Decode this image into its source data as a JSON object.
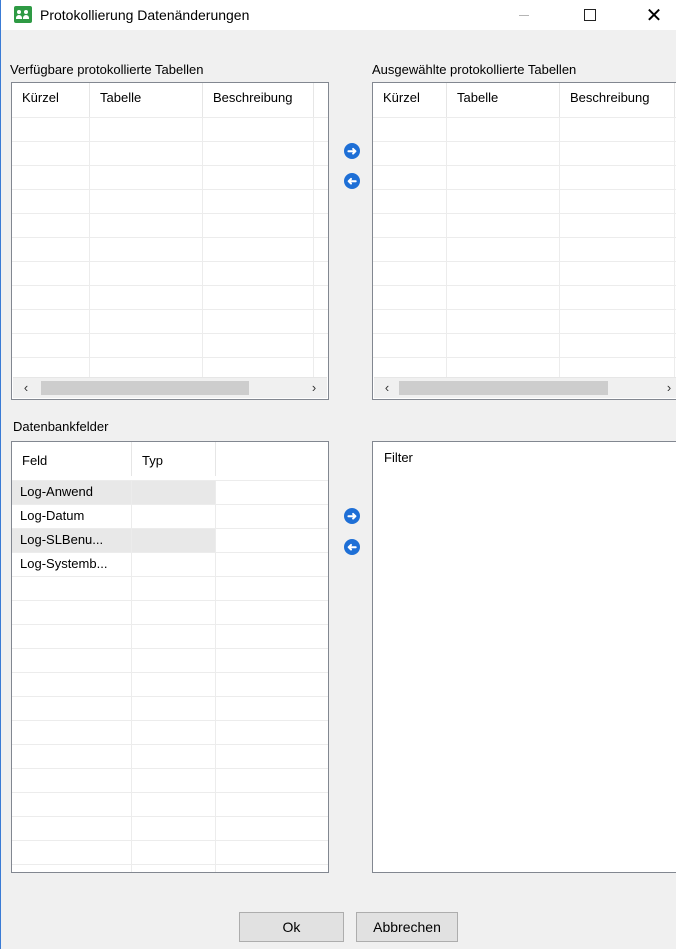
{
  "window": {
    "title": "Protokollierung Datenänderungen"
  },
  "available_tables": {
    "label": "Verfügbare protokollierte Tabellen",
    "columns": [
      "Kürzel",
      "Tabelle",
      "Beschreibung"
    ]
  },
  "selected_tables": {
    "label": "Ausgewählte protokollierte Tabellen",
    "columns": [
      "Kürzel",
      "Tabelle",
      "Beschreibung"
    ]
  },
  "database_fields": {
    "label": "Datenbankfelder",
    "columns": [
      "Feld",
      "Typ"
    ],
    "rows": [
      {
        "feld": "Log-Anwend",
        "typ": ""
      },
      {
        "feld": "Log-Datum",
        "typ": ""
      },
      {
        "feld": "Log-SLBenu...",
        "typ": ""
      },
      {
        "feld": "Log-Systemb...",
        "typ": ""
      }
    ]
  },
  "filter": {
    "label": "Filter"
  },
  "buttons": {
    "ok": "Ok",
    "cancel": "Abbrechen"
  },
  "scroll": {
    "left": "‹",
    "right": "›"
  },
  "icons": {
    "add": "➜",
    "remove": "➜"
  }
}
